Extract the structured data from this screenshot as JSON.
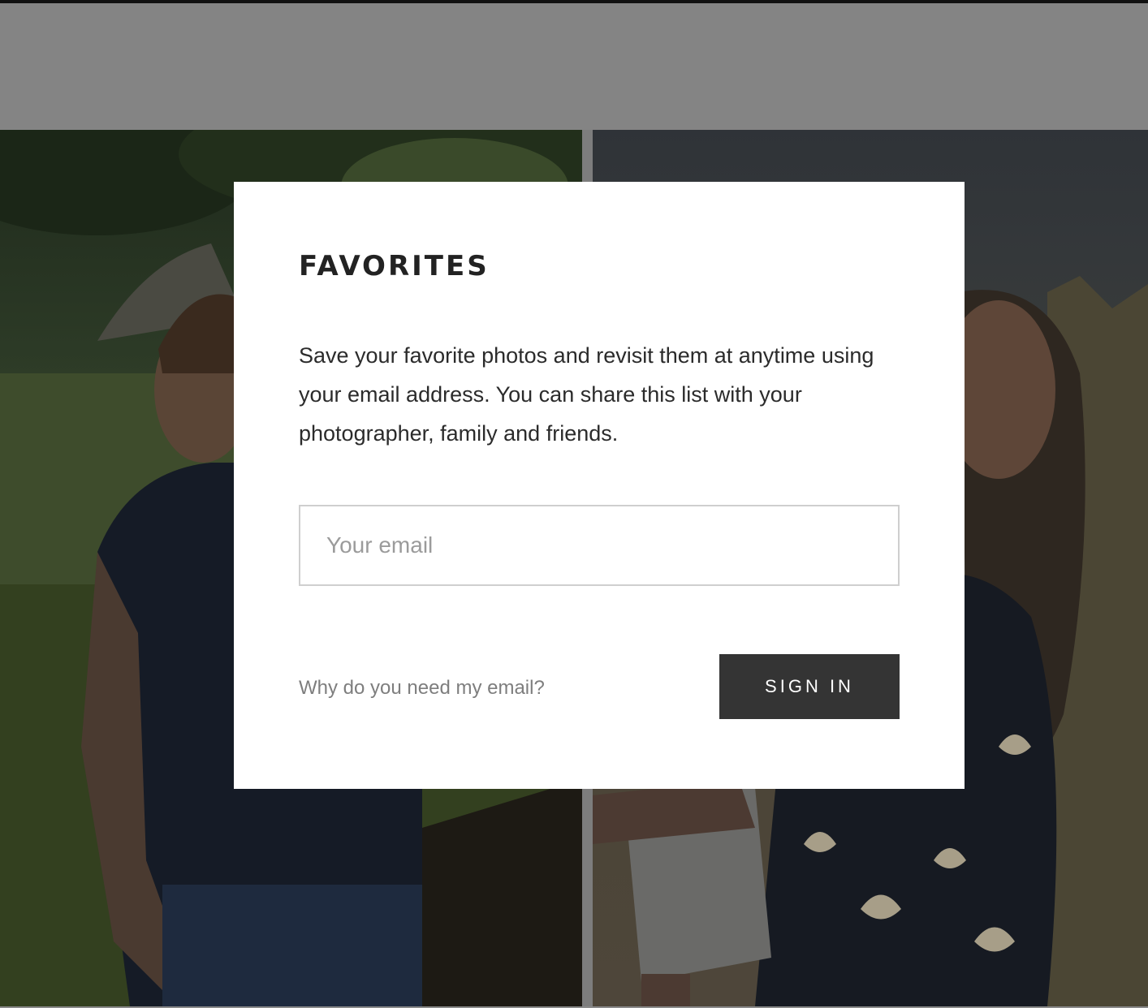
{
  "modal": {
    "title": "FAVORITES",
    "description": "Save your favorite photos and revisit them at anytime using your email address. You can share this list with your photographer, family and friends.",
    "email_placeholder": "Your email",
    "email_value": "",
    "why_link": "Why do you need my email?",
    "signin_label": "SIGN IN"
  },
  "gallery": {
    "photos": [
      {
        "subject": "boy-in-tall-grass"
      },
      {
        "subject": "woman-in-floral-dress"
      }
    ]
  },
  "colors": {
    "overlay": "#7c7c7c",
    "modal_bg": "#ffffff",
    "button_bg": "#343434",
    "button_text": "#ffffff",
    "title_text": "#222222",
    "link_text": "#7e7e7e",
    "input_border": "#cfcfcf"
  }
}
